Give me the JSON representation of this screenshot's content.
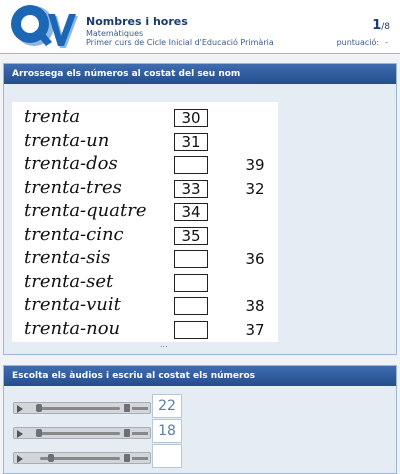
{
  "header": {
    "title": "Nombres i hores",
    "subject": "Matemàtiques",
    "course": "Primer curs de Cicle Inicial d'Educació Primària",
    "page_current": "1",
    "page_total": "/8",
    "score_label": "puntuació:",
    "score_value": "-",
    "logo_text": "QV",
    "colors": {
      "logo_blue": "#1b67b5",
      "logo_shadow": "#8fb7e4",
      "header_bar": "#2b5797"
    }
  },
  "drag_section": {
    "title": "Arrossega els números al costat del seu nom",
    "rows": [
      {
        "word": "trenta",
        "slot": "30",
        "tile": ""
      },
      {
        "word": "trenta-un",
        "slot": "31",
        "tile": ""
      },
      {
        "word": "trenta-dos",
        "slot": "",
        "tile": "39"
      },
      {
        "word": "trenta-tres",
        "slot": "33",
        "tile": "32"
      },
      {
        "word": "trenta-quatre",
        "slot": "34",
        "tile": ""
      },
      {
        "word": "trenta-cinc",
        "slot": "35",
        "tile": ""
      },
      {
        "word": "trenta-sis",
        "slot": "",
        "tile": "36"
      },
      {
        "word": "trenta-set",
        "slot": "",
        "tile": ""
      },
      {
        "word": "trenta-vuit",
        "slot": "",
        "tile": "38"
      },
      {
        "word": "trenta-nou",
        "slot": "",
        "tile": "37"
      }
    ]
  },
  "audio_section": {
    "title": "Escolta els àudios i escriu al costat els números",
    "items": [
      {
        "answer": "22",
        "progress": 0.0
      },
      {
        "answer": "18",
        "progress": 0.0
      },
      {
        "answer": "",
        "progress": 0.15
      }
    ]
  }
}
